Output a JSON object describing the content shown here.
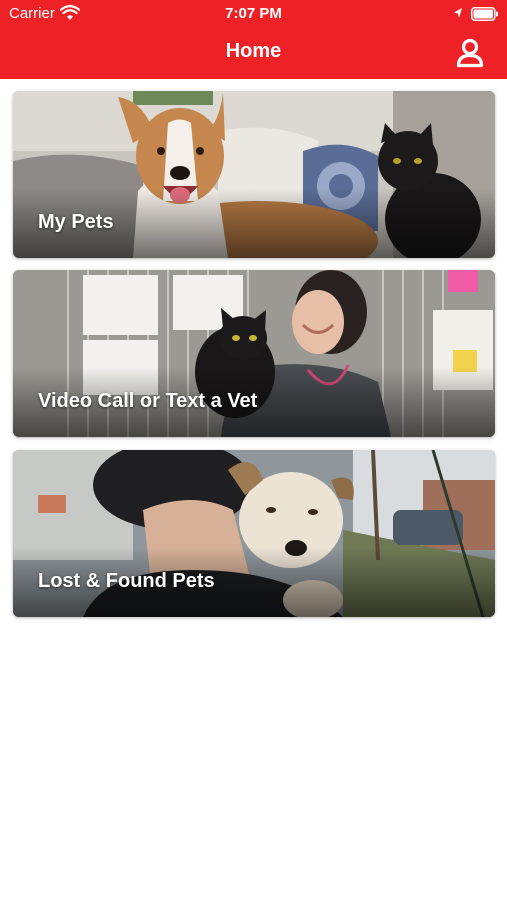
{
  "status_bar": {
    "carrier": "Carrier",
    "time": "7:07 PM"
  },
  "header": {
    "title": "Home",
    "profile_icon": "user-profile-icon"
  },
  "cards": [
    {
      "label": "My Pets",
      "image": "dog-and-black-cat-photo"
    },
    {
      "label": "Video Call or Text a Vet",
      "image": "vet-holding-black-cat-photo"
    },
    {
      "label": "Lost & Found Pets",
      "image": "person-hugging-dog-photo"
    }
  ],
  "colors": {
    "brand_red": "#ee2226",
    "background": "#ffffff",
    "label_text": "#ffffff"
  }
}
